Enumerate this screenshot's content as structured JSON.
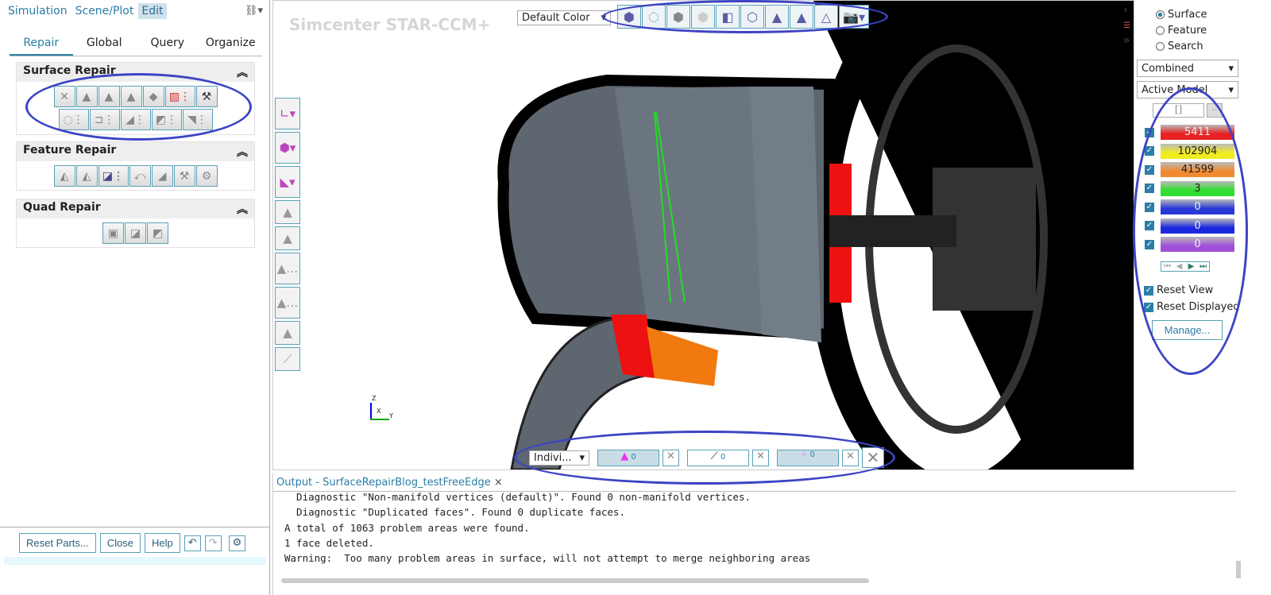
{
  "menu": {
    "items": [
      "Simulation",
      "Scene/Plot",
      "Edit"
    ],
    "active": "Edit"
  },
  "tabs": [
    "Repair",
    "Global",
    "Query",
    "Organize"
  ],
  "sections": {
    "surface": "Surface Repair",
    "feature": "Feature Repair",
    "quad": "Quad Repair"
  },
  "footer": {
    "reset": "Reset Parts...",
    "close": "Close",
    "help": "Help"
  },
  "viewport": {
    "brand": "Simcenter STAR-CCM+",
    "color_mode": "Default Color",
    "axes": {
      "z": "Z",
      "x": "X",
      "y": "Y"
    }
  },
  "selection_bar": {
    "mode": "Indivi...",
    "faces": "0",
    "edges": "0",
    "vertices": "0"
  },
  "right": {
    "radios": [
      "Surface",
      "Feature",
      "Search"
    ],
    "selected": "Surface",
    "combo1": "Combined",
    "combo2": "Active Model",
    "range": "[]",
    "range_btn": "..",
    "counts": [
      {
        "value": "5411",
        "color": "#e82020"
      },
      {
        "value": "102904",
        "color": "#f0ec20"
      },
      {
        "value": "41599",
        "color": "#f08a30"
      },
      {
        "value": "3",
        "color": "#30dd30"
      },
      {
        "value": "0",
        "color": "#2838d8"
      },
      {
        "value": "0",
        "color": "#1c28e0"
      },
      {
        "value": "0",
        "color": "#a050d8"
      }
    ],
    "reset_view": "Reset View",
    "reset_displayed": "Reset Displayed",
    "manage": "Manage..."
  },
  "output": {
    "tab": "Output - SurfaceRepairBlog_testFreeEdge",
    "close": "×",
    "lines": [
      "  Diagnostic \"Non-manifold vertices (default)\". Found 0 non-manifold vertices.",
      "  Diagnostic \"Duplicated faces\". Found 0 duplicate faces.",
      "A total of 1063 problem areas were found.",
      "1 face deleted.",
      "Warning:  Too many problem areas in surface, will not attempt to merge neighboring areas"
    ]
  },
  "annotation_color": "#3d44c4"
}
